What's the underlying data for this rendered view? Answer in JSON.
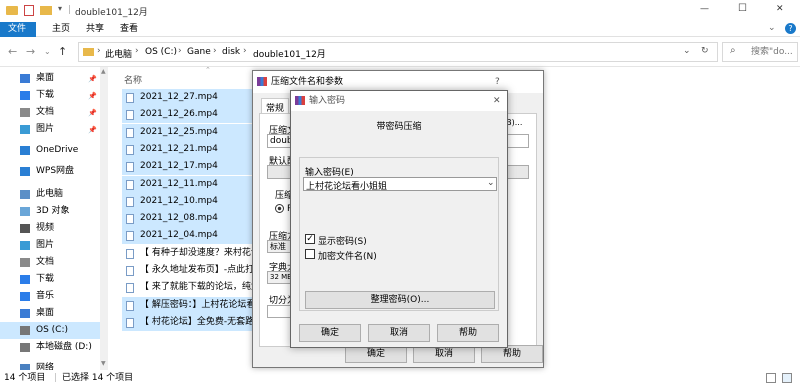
{
  "window": {
    "title": "double101_12月",
    "minimize": "—",
    "maximize": "☐",
    "close": "✕"
  },
  "ribbon": {
    "tabs": [
      "文件",
      "主页",
      "共享",
      "查看"
    ]
  },
  "address": {
    "path": [
      "此电脑",
      "OS (C:)",
      "Gane",
      "disk",
      "double101_12月"
    ],
    "search_placeholder": "搜索\"do..."
  },
  "sidebar": {
    "items": [
      {
        "label": "桌面",
        "icon": "desktop-icon",
        "pinned": true
      },
      {
        "label": "下载",
        "icon": "download-icon",
        "pinned": true
      },
      {
        "label": "文档",
        "icon": "document-icon",
        "pinned": true
      },
      {
        "label": "图片",
        "icon": "picture-icon",
        "pinned": true
      },
      {
        "label": "OneDrive",
        "icon": "cloud-icon",
        "pinned": false
      },
      {
        "label": "WPS网盘",
        "icon": "cloud-icon",
        "pinned": false
      },
      {
        "label": "此电脑",
        "icon": "computer-icon",
        "pinned": false
      },
      {
        "label": "3D 对象",
        "icon": "cube-icon",
        "pinned": false
      },
      {
        "label": "视频",
        "icon": "video-icon",
        "pinned": false
      },
      {
        "label": "图片",
        "icon": "picture-icon",
        "pinned": false
      },
      {
        "label": "文档",
        "icon": "document-icon",
        "pinned": false
      },
      {
        "label": "下载",
        "icon": "download-icon",
        "pinned": false
      },
      {
        "label": "音乐",
        "icon": "music-icon",
        "pinned": false
      },
      {
        "label": "桌面",
        "icon": "desktop-icon",
        "pinned": false
      },
      {
        "label": "OS (C:)",
        "icon": "drive-icon",
        "pinned": false
      },
      {
        "label": "本地磁盘 (D:)",
        "icon": "drive-icon",
        "pinned": false
      },
      {
        "label": "网络",
        "icon": "network-icon",
        "pinned": false
      }
    ]
  },
  "files": {
    "column_name": "名称",
    "rows": [
      "2021_12_27.mp4",
      "2021_12_26.mp4",
      "2021_12_25.mp4",
      "2021_12_21.mp4",
      "2021_12_17.mp4",
      "2021_12_11.mp4",
      "2021_12_10.mp4",
      "2021_12_08.mp4",
      "2021_12_04.mp4",
      "【 有种子却没速度？来村花论坛",
      "【 永久地址发布页】-点此打开",
      "【 来了就能下载的论坛，纯免",
      "【 解压密码：】上村花论坛看小",
      "【 村花论坛】全免费-无套路-"
    ]
  },
  "status": {
    "count": "14 个项目",
    "selected": "已选择 14 个项目"
  },
  "dialog_archive": {
    "title": "压缩文件名和参数",
    "help_char": "?",
    "tab": "常规",
    "labels": {
      "archive_name": "压缩文",
      "default": "默认配",
      "format": "压缩",
      "format_option": "RA",
      "method": "压缩方",
      "method_value": "标准",
      "dict": "字典大",
      "dict_value": "32 MB",
      "split": "切分为"
    },
    "archive_value": "double",
    "browse": "(B)...",
    "ok": "确定",
    "cancel": "取消",
    "help": "帮助"
  },
  "dialog_password": {
    "title": "输入密码",
    "close": "✕",
    "heading": "带密码压缩",
    "password_label": "输入密码(E)",
    "password_value": "上村花论坛看小姐姐",
    "show_password": "显示密码(S)",
    "show_password_checked": true,
    "encrypt_names": "加密文件名(N)",
    "encrypt_names_checked": false,
    "organize": "整理密码(O)...",
    "ok": "确定",
    "cancel": "取消",
    "help": "帮助"
  }
}
